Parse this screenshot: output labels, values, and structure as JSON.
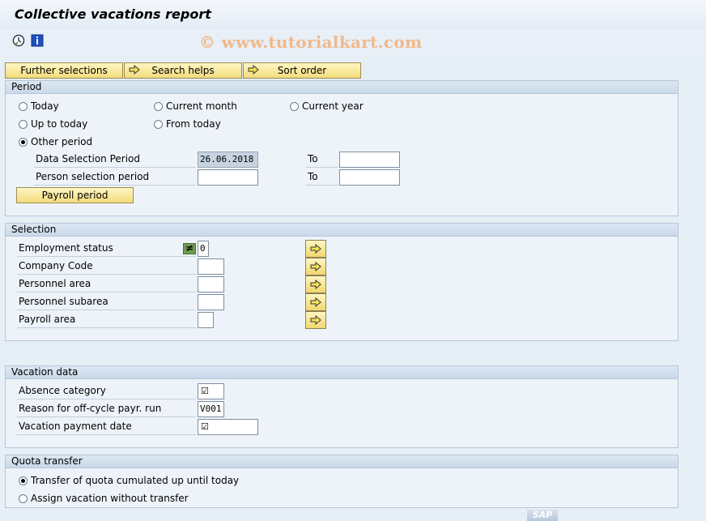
{
  "window": {
    "title": "Collective vacations report"
  },
  "watermark": "© www.tutorialkart.com",
  "toolbar": {
    "execute_icon": "execute-clock-icon",
    "info_icon": "info-icon"
  },
  "buttons": {
    "further_selections": "Further selections",
    "search_helps": "Search helps",
    "sort_order": "Sort order"
  },
  "period": {
    "title": "Period",
    "today": "Today",
    "current_month": "Current month",
    "current_year": "Current year",
    "up_to_today": "Up to today",
    "from_today": "From today",
    "other_period": "Other period",
    "selected": "other_period",
    "data_selection_period": "Data Selection Period",
    "data_selection_from": "26.06.2018",
    "data_selection_to": "",
    "person_selection_period": "Person selection period",
    "person_selection_from": "",
    "person_selection_to": "",
    "to_label": "To",
    "payroll_period_button": "Payroll period"
  },
  "selection": {
    "title": "Selection",
    "employment_status": "Employment status",
    "employment_status_value": "0",
    "employment_status_option": "≠",
    "company_code": "Company Code",
    "personnel_area": "Personnel area",
    "personnel_subarea": "Personnel subarea",
    "payroll_area": "Payroll area"
  },
  "vacation_data": {
    "title": "Vacation data",
    "absence_category": "Absence category",
    "absence_category_value": "☑",
    "reason_offcycle": "Reason for off-cycle payr. run",
    "reason_offcycle_value": "V001",
    "vacation_payment_date": "Vacation payment date",
    "vacation_payment_date_value": "☑"
  },
  "quota_transfer": {
    "title": "Quota transfer",
    "transfer_quota": "Transfer of quota cumulated up until today",
    "assign_without": "Assign vacation without transfer",
    "selected": "transfer_quota"
  },
  "logo": "SAP"
}
